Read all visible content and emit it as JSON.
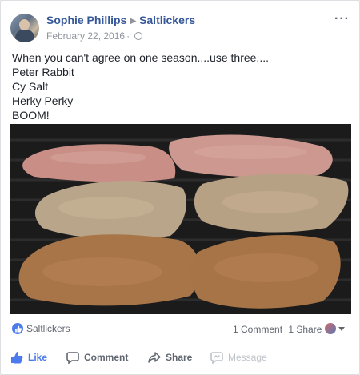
{
  "post": {
    "author": "Sophie Phillips",
    "group": "Saltlickers",
    "date": "February 22, 2016",
    "more_label": "···",
    "lines": [
      "When you can't agree on one season....use three....",
      "Peter Rabbit",
      "Cy Salt",
      "Herky Perky",
      "BOOM!"
    ]
  },
  "reactions": {
    "label": "Saltlickers",
    "comments": "1 Comment",
    "shares": "1 Share"
  },
  "actions": {
    "like": "Like",
    "comment": "Comment",
    "share": "Share",
    "message": "Message"
  },
  "icons": {
    "like": "thumbs-up-icon",
    "comment": "speech-bubble-icon",
    "share": "share-arrow-icon",
    "message": "message-icon",
    "privacy": "globe-icon"
  },
  "colors": {
    "link": "#365899",
    "like_active": "#4b7bec",
    "muted": "#90949c"
  }
}
